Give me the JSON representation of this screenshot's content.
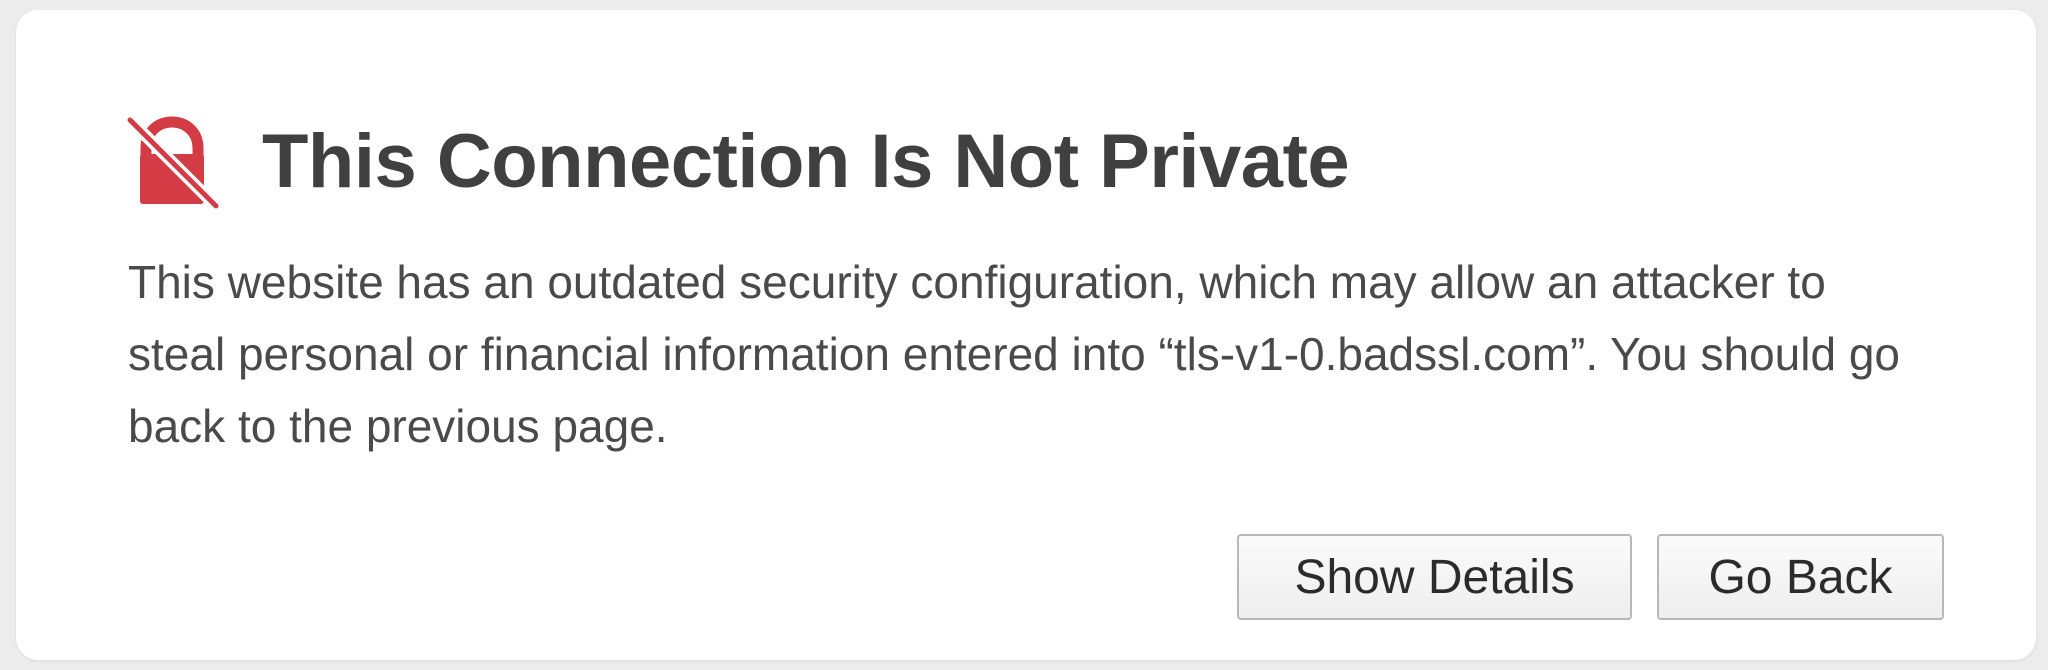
{
  "warning": {
    "icon": "broken-lock-icon",
    "icon_color": "#d43c45",
    "title": "This Connection Is Not Private",
    "message": "This website has an outdated security configuration, which may allow an attacker to steal personal or financial information entered into “tls-v1-0.badssl.com”. You should go back to the previous page."
  },
  "actions": {
    "show_details_label": "Show Details",
    "go_back_label": "Go Back"
  }
}
